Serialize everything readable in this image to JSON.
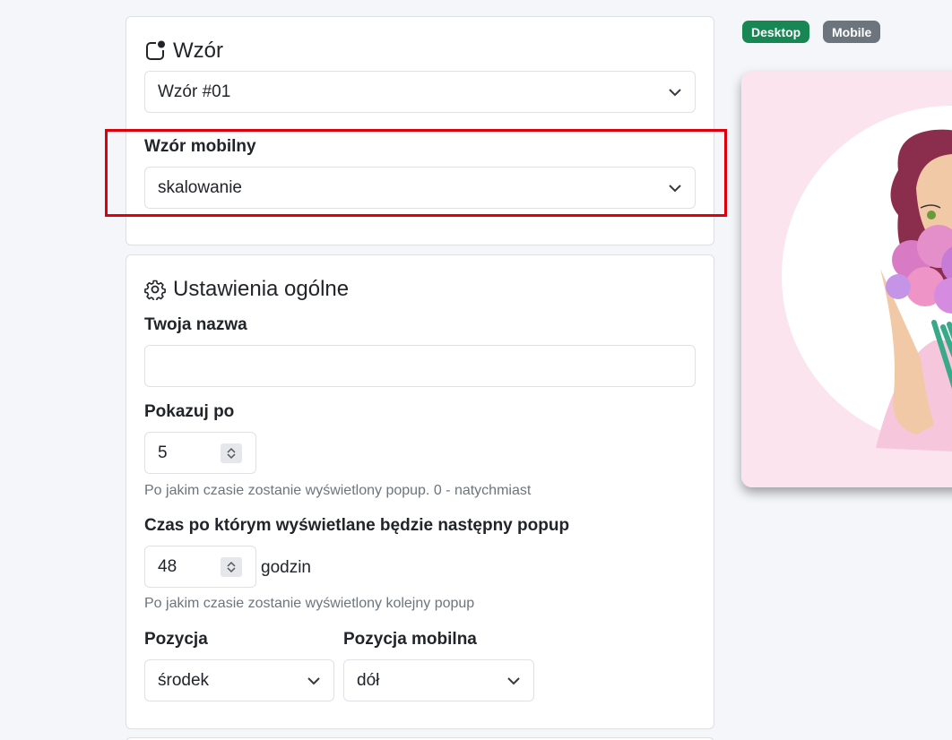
{
  "template_section": {
    "title": "Wzór",
    "template_select": {
      "value": "Wzór #01"
    },
    "mobile_label": "Wzór mobilny",
    "mobile_select": {
      "value": "skalowanie"
    }
  },
  "general_section": {
    "title": "Ustawienia ogólne",
    "name_label": "Twoja nazwa",
    "name_input": {
      "value": ""
    },
    "show_after_label": "Pokazuj po",
    "show_after_value": "5",
    "show_after_help": "Po jakim czasie zostanie wyświetlony popup. 0 - natychmiast",
    "next_popup_label": "Czas po którym wyświetlane będzie następny popup",
    "next_popup_value": "48",
    "next_popup_unit": "godzin",
    "next_popup_help": "Po jakim czasie zostanie wyświetlony kolejny popup",
    "position_label": "Pozycja",
    "position_value": "środek",
    "mobile_position_label": "Pozycja mobilna",
    "mobile_position_value": "dół"
  },
  "preview_toggle": {
    "desktop": "Desktop",
    "mobile": "Mobile"
  },
  "colors": {
    "desktop_badge": "#198754",
    "mobile_badge": "#6c757d",
    "highlight": "#e0000b",
    "preview_bg": "#fbe4ee"
  },
  "icons": {
    "template": "template-icon",
    "settings": "gear-icon",
    "dropdown": "chevron-down-icon"
  }
}
